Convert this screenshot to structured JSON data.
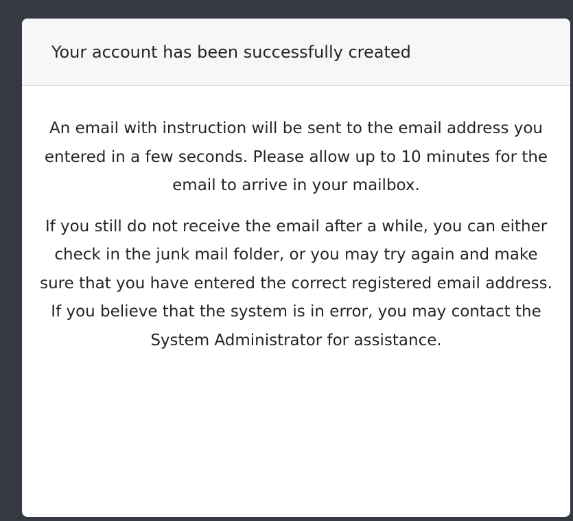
{
  "card": {
    "header_title": "Your account has been successfully created",
    "paragraphs": [
      "An email with instruction will be sent to the email address you entered in a few seconds. Please allow up to 10 minutes for the email to arrive in your mailbox.",
      "If you still do not receive the email after a while, you can either check in the junk mail folder, or you may try again and make sure that you have entered the correct registered email address. If you believe that the system is in error, you may contact the System Administrator for assistance."
    ]
  },
  "colors": {
    "page_background": "#343a40",
    "card_background": "#ffffff",
    "header_background": "#f7f7f7",
    "text": "#212529"
  }
}
